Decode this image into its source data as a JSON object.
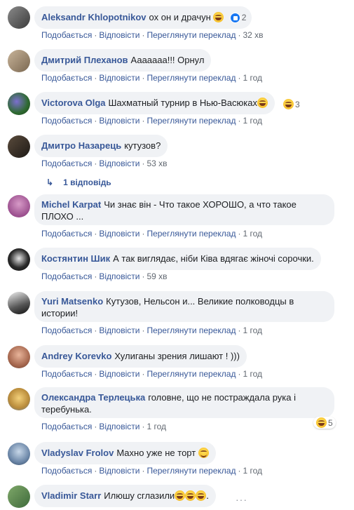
{
  "actions": {
    "like": "Подобається",
    "reply": "Відповісти",
    "translate": "Переглянути переклад"
  },
  "comments": [
    {
      "author": "Aleksandr Khlopotnikov",
      "text": "ох он и драчун",
      "reactions": "2",
      "time": "32 хв"
    },
    {
      "author": "Дмитрий Плеханов",
      "text": "Ааааааа!!! Орнул",
      "time": "1 год"
    },
    {
      "author": "Victorova Olga",
      "text": "Шахматный турнир в Нью-Васюках",
      "reactions": "3",
      "time": "1 год"
    },
    {
      "author": "Дмитро Назарець",
      "text": "кутузов?",
      "time": "53 хв"
    },
    {
      "author": "Michel Karpat",
      "text": "Чи знає він - Что такое ХОРОШО, а что такое ПЛОХО ...",
      "time": "1 год"
    },
    {
      "author": "Костянтин Шик",
      "text": "А так виглядає, ніби Ківа вдягає жіночі сорочки.",
      "time": "59 хв"
    },
    {
      "author": "Yuri Matsenko",
      "text": "Кутузов, Нельсон и... Великие полководцы в истории!",
      "time": "1 год"
    },
    {
      "author": "Andrey Korevko",
      "text": "Хулиганы зрения лишают ! )))",
      "time": "1 год"
    },
    {
      "author": "Олександра Терлецька",
      "text": "головне, що не постраждала рука і теребунька.",
      "reactions": "5",
      "time": "1 год"
    },
    {
      "author": "Vladyslav Frolov",
      "text": "Махно уже не торт",
      "time": "1 год"
    },
    {
      "author": "Vladimir Starr",
      "text": "Илюшу сглазили",
      "time": ""
    }
  ],
  "replies_link": "1 відповідь",
  "colors": {
    "link": "#385898",
    "bubble": "#f0f2f5",
    "meta": "#606770",
    "like": "#1877f2"
  }
}
